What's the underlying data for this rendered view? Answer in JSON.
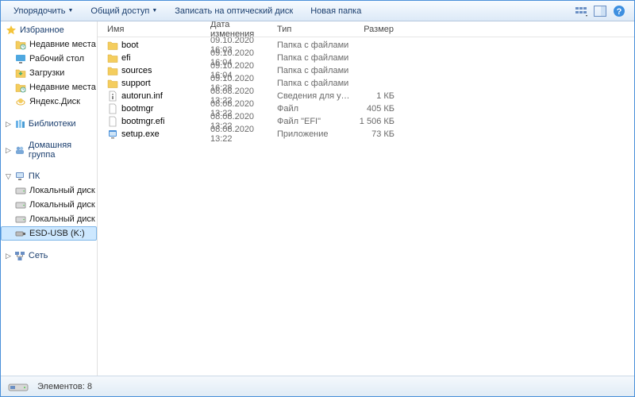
{
  "toolbar": {
    "organize": "Упорядочить",
    "share": "Общий доступ",
    "burn": "Записать на оптический диск",
    "newfolder": "Новая папка"
  },
  "columns": {
    "name": "Имя",
    "date": "Дата изменения",
    "type": "Тип",
    "size": "Размер"
  },
  "sidebar": {
    "favorites": "Избранное",
    "fav_items": [
      "Недавние места",
      "Рабочий стол",
      "Загрузки",
      "Недавние места",
      "Яндекс.Диск"
    ],
    "libraries": "Библиотеки",
    "homegroup": "Домашняя группа",
    "computer": "ПК",
    "drives": [
      "Локальный диск (C",
      "Локальный диск (D",
      "Локальный диск (E",
      "ESD-USB (K:)"
    ],
    "network": "Сеть"
  },
  "files": [
    {
      "icon": "folder",
      "name": "boot",
      "date": "09.10.2020 16:03",
      "type": "Папка с файлами",
      "size": ""
    },
    {
      "icon": "folder",
      "name": "efi",
      "date": "09.10.2020 16:04",
      "type": "Папка с файлами",
      "size": ""
    },
    {
      "icon": "folder",
      "name": "sources",
      "date": "09.10.2020 16:04",
      "type": "Папка с файлами",
      "size": ""
    },
    {
      "icon": "folder",
      "name": "support",
      "date": "09.10.2020 16:28",
      "type": "Папка с файлами",
      "size": ""
    },
    {
      "icon": "inf",
      "name": "autorun.inf",
      "date": "08.08.2020 13:22",
      "type": "Сведения для уст...",
      "size": "1 КБ"
    },
    {
      "icon": "file",
      "name": "bootmgr",
      "date": "08.08.2020 13:22",
      "type": "Файл",
      "size": "405 КБ"
    },
    {
      "icon": "file",
      "name": "bootmgr.efi",
      "date": "08.08.2020 13:22",
      "type": "Файл \"EFI\"",
      "size": "1 506 КБ"
    },
    {
      "icon": "exe",
      "name": "setup.exe",
      "date": "08.08.2020 13:22",
      "type": "Приложение",
      "size": "73 КБ"
    }
  ],
  "status": {
    "label": "Элементов: 8"
  },
  "colors": {
    "accent": "#4a90d9"
  }
}
